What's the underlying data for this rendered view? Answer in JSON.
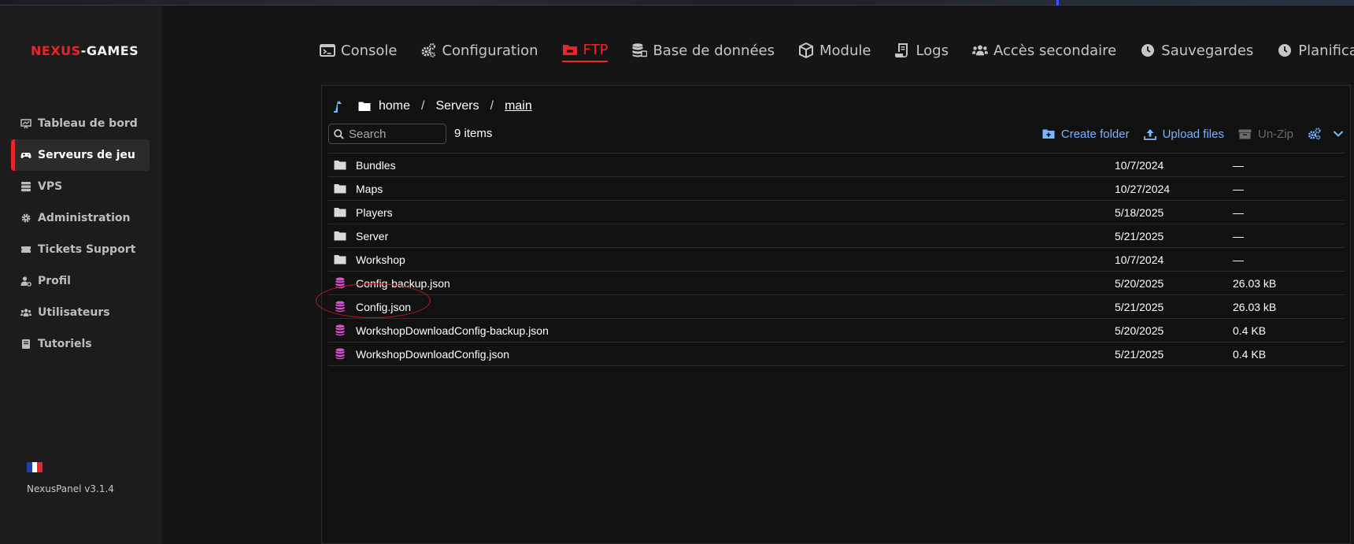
{
  "brand": {
    "part1": "NEXUS",
    "part2": "-GAMES",
    "accent": "#e8262a"
  },
  "sidebar": {
    "items": [
      {
        "label": "Tableau de bord",
        "icon": "dashboard-icon"
      },
      {
        "label": "Serveurs de jeu",
        "icon": "gamepad-icon",
        "active": true
      },
      {
        "label": "VPS",
        "icon": "server-icon"
      },
      {
        "label": "Administration",
        "icon": "gear-icon"
      },
      {
        "label": "Tickets Support",
        "icon": "ticket-icon"
      },
      {
        "label": "Profil",
        "icon": "user-gear-icon"
      },
      {
        "label": "Utilisateurs",
        "icon": "users-icon"
      },
      {
        "label": "Tutoriels",
        "icon": "book-icon"
      }
    ],
    "language_flag": "fr-flag-icon",
    "version": "NexusPanel v3.1.4"
  },
  "tabs": [
    {
      "label": "Console",
      "icon": "terminal-icon"
    },
    {
      "label": "Configuration",
      "icon": "cogs-icon"
    },
    {
      "label": "FTP",
      "icon": "folder-icon",
      "active": true
    },
    {
      "label": "Base de données",
      "icon": "database-icon"
    },
    {
      "label": "Module",
      "icon": "cube-icon"
    },
    {
      "label": "Logs",
      "icon": "scroll-icon"
    },
    {
      "label": "Accès secondaire",
      "icon": "users-icon"
    },
    {
      "label": "Sauvegardes",
      "icon": "clock-icon"
    },
    {
      "label": "Planification",
      "icon": "clock-icon"
    }
  ],
  "breadcrumb": {
    "parts": [
      "home",
      "Servers",
      "main"
    ],
    "separator": "/"
  },
  "search": {
    "placeholder": "Search",
    "value": ""
  },
  "item_count": "9 items",
  "actions": {
    "create_folder": "Create folder",
    "upload_files": "Upload files",
    "unzip": "Un-Zip"
  },
  "files": [
    {
      "name": "Bundles",
      "type": "folder",
      "date": "10/7/2024",
      "size": "—"
    },
    {
      "name": "Maps",
      "type": "folder",
      "date": "10/27/2024",
      "size": "—"
    },
    {
      "name": "Players",
      "type": "folder",
      "date": "5/18/2025",
      "size": "—"
    },
    {
      "name": "Server",
      "type": "folder",
      "date": "5/21/2025",
      "size": "—"
    },
    {
      "name": "Workshop",
      "type": "folder",
      "date": "10/7/2024",
      "size": "—"
    },
    {
      "name": "Config-backup.json",
      "type": "file",
      "date": "5/20/2025",
      "size": "26.03 kB"
    },
    {
      "name": "Config.json",
      "type": "file",
      "date": "5/21/2025",
      "size": "26.03 kB",
      "circled": true
    },
    {
      "name": "WorkshopDownloadConfig-backup.json",
      "type": "file",
      "date": "5/20/2025",
      "size": "0.4 KB"
    },
    {
      "name": "WorkshopDownloadConfig.json",
      "type": "file",
      "date": "5/21/2025",
      "size": "0.4 KB"
    }
  ],
  "colors": {
    "accent_red": "#e8262a",
    "link_blue": "#79b6ff",
    "file_icon": "#d94ed3",
    "folder_icon": "#d9d9d9",
    "flag": [
      "#1f3fa8",
      "#ffffff",
      "#e8262a"
    ]
  }
}
